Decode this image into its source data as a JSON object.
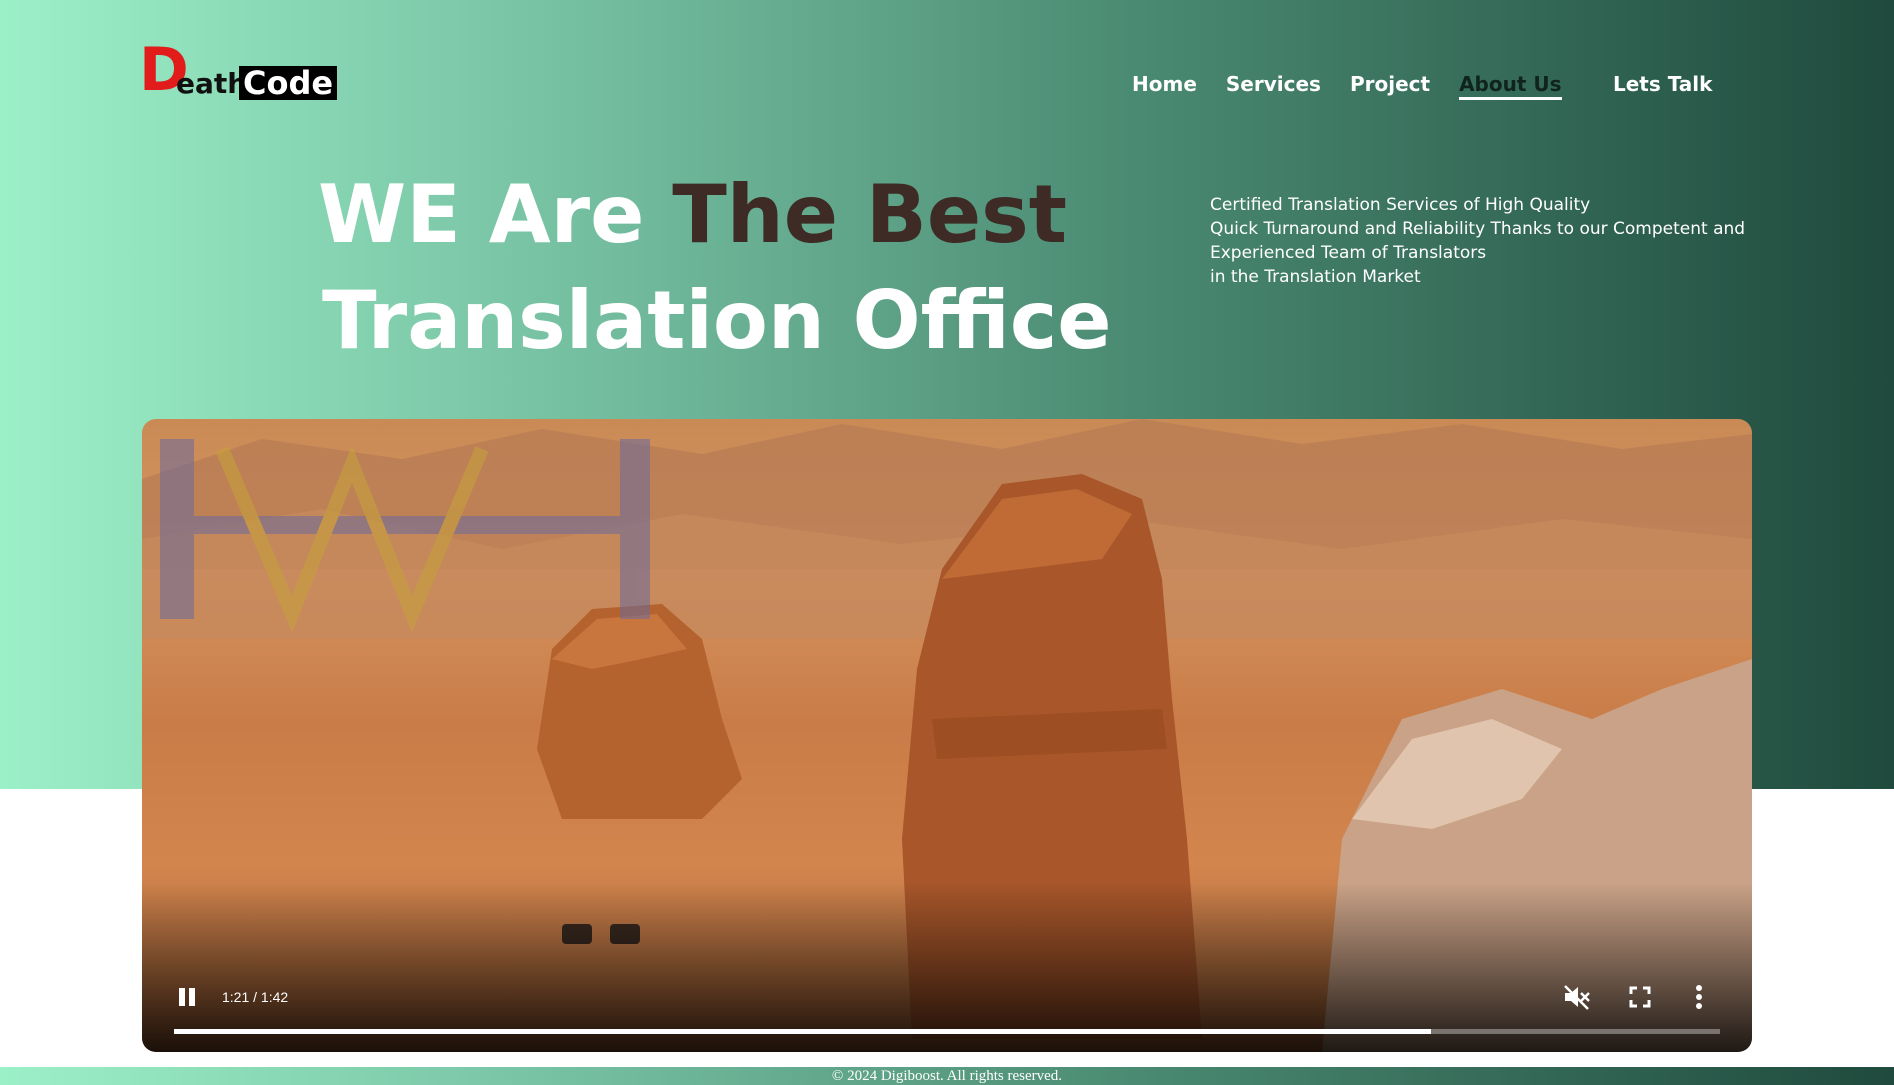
{
  "logo": {
    "initial": "D",
    "part1": "eath",
    "part2": "Code"
  },
  "nav": {
    "items": [
      {
        "label": "Home",
        "active": false
      },
      {
        "label": "Services",
        "active": false
      },
      {
        "label": "Project",
        "active": false
      },
      {
        "label": "About Us",
        "active": true
      }
    ],
    "cta_label": "Lets Talk"
  },
  "hero": {
    "headline_part1": "WE Are ",
    "headline_part2": "The Best",
    "headline_line2": "Translation Office",
    "tagline": [
      "Certified Translation Services of High Quality",
      "Quick Turnaround and Reliability Thanks to our Competent and",
      "Experienced Team of Translators",
      "in the Translation Market"
    ]
  },
  "video": {
    "time": "1:21 / 1:42",
    "progress": 0.813,
    "state": "playing",
    "muted": true,
    "controls": [
      "pause-icon",
      "volume-muted-icon",
      "fullscreen-icon",
      "more-vertical-icon"
    ]
  },
  "footer": {
    "copyright": "© 2024 Digiboost. All rights reserved."
  },
  "colors": {
    "gradient_start": "#9cf0c8",
    "gradient_end": "#1f4a3d",
    "accent_dark": "#3f2b26",
    "logo_red": "#e21b1b"
  }
}
